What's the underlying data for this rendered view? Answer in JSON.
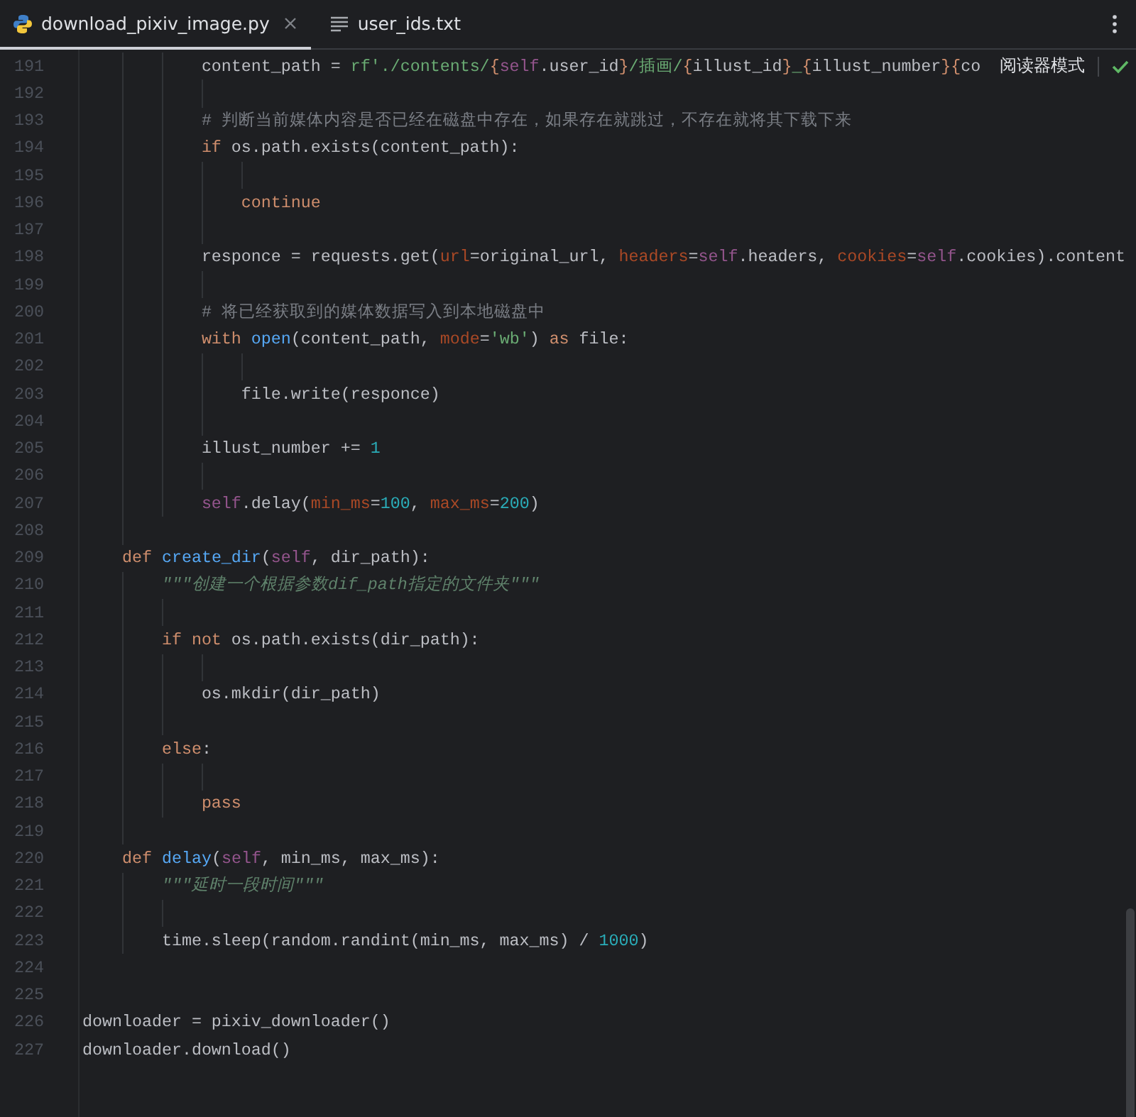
{
  "tabs": [
    {
      "label": "download_pixiv_image.py",
      "kind": "python",
      "selected": true,
      "closable": true
    },
    {
      "label": "user_ids.txt",
      "kind": "text",
      "selected": false,
      "closable": false
    }
  ],
  "reader_mode": {
    "label": "阅读器模式"
  },
  "code_lines": [
    {
      "number": "191",
      "tokens": [
        {
          "t": "            content_path = ",
          "kind": "plain"
        },
        {
          "t": "rf'./contents/",
          "kind": "str"
        },
        {
          "t": "{",
          "kind": "brace"
        },
        {
          "t": "self",
          "kind": "self"
        },
        {
          "t": ".user_id",
          "kind": "plain"
        },
        {
          "t": "}",
          "kind": "brace"
        },
        {
          "t": "/插画/",
          "kind": "str"
        },
        {
          "t": "{",
          "kind": "brace"
        },
        {
          "t": "illust_id",
          "kind": "plain"
        },
        {
          "t": "}",
          "kind": "brace"
        },
        {
          "t": "_",
          "kind": "str"
        },
        {
          "t": "{",
          "kind": "brace"
        },
        {
          "t": "illust_number",
          "kind": "plain"
        },
        {
          "t": "}{",
          "kind": "brace"
        },
        {
          "t": "co",
          "kind": "plain"
        }
      ]
    },
    {
      "number": "192"
    },
    {
      "number": "193",
      "tokens": [
        {
          "t": "            # 判断当前媒体内容是否已经在磁盘中存在，如果存在就跳过，不存在就将其下载下来",
          "kind": "comment"
        }
      ]
    },
    {
      "number": "194",
      "tokens": [
        {
          "t": "            if",
          "kind": "kw"
        },
        {
          "t": " os.path.exists(content_path):",
          "kind": "plain"
        }
      ]
    },
    {
      "number": "195"
    },
    {
      "number": "196",
      "tokens": [
        {
          "t": "                continue",
          "kind": "kw"
        }
      ]
    },
    {
      "number": "197"
    },
    {
      "number": "198",
      "tokens": [
        {
          "t": "            responce = requests.get(",
          "kind": "plain"
        },
        {
          "t": "url",
          "kind": "arg"
        },
        {
          "t": "=original_url, ",
          "kind": "plain"
        },
        {
          "t": "headers",
          "kind": "arg"
        },
        {
          "t": "=",
          "kind": "plain"
        },
        {
          "t": "self",
          "kind": "self"
        },
        {
          "t": ".headers, ",
          "kind": "plain"
        },
        {
          "t": "cookies",
          "kind": "arg"
        },
        {
          "t": "=",
          "kind": "plain"
        },
        {
          "t": "self",
          "kind": "self"
        },
        {
          "t": ".cookies).content",
          "kind": "plain"
        }
      ]
    },
    {
      "number": "199"
    },
    {
      "number": "200",
      "tokens": [
        {
          "t": "            # 将已经获取到的媒体数据写入到本地磁盘中",
          "kind": "comment"
        }
      ]
    },
    {
      "number": "201",
      "tokens": [
        {
          "t": "            with",
          "kind": "kw"
        },
        {
          "t": " open",
          "kind": "fn"
        },
        {
          "t": "(content_path, ",
          "kind": "plain"
        },
        {
          "t": "mode",
          "kind": "arg"
        },
        {
          "t": "=",
          "kind": "plain"
        },
        {
          "t": "'wb'",
          "kind": "str"
        },
        {
          "t": ") ",
          "kind": "plain"
        },
        {
          "t": "as",
          "kind": "kw"
        },
        {
          "t": " file:",
          "kind": "plain"
        }
      ]
    },
    {
      "number": "202"
    },
    {
      "number": "203",
      "tokens": [
        {
          "t": "                file.write(responce)",
          "kind": "plain"
        }
      ]
    },
    {
      "number": "204"
    },
    {
      "number": "205",
      "tokens": [
        {
          "t": "            illust_number += ",
          "kind": "plain"
        },
        {
          "t": "1",
          "kind": "num"
        }
      ]
    },
    {
      "number": "206"
    },
    {
      "number": "207",
      "tokens": [
        {
          "t": "            self",
          "kind": "self"
        },
        {
          "t": ".delay(",
          "kind": "plain"
        },
        {
          "t": "min_ms",
          "kind": "arg"
        },
        {
          "t": "=",
          "kind": "plain"
        },
        {
          "t": "100",
          "kind": "num"
        },
        {
          "t": ", ",
          "kind": "plain"
        },
        {
          "t": "max_ms",
          "kind": "arg"
        },
        {
          "t": "=",
          "kind": "plain"
        },
        {
          "t": "200",
          "kind": "num"
        },
        {
          "t": ")",
          "kind": "plain"
        }
      ]
    },
    {
      "number": "208"
    },
    {
      "number": "209",
      "tokens": [
        {
          "t": "    def",
          "kind": "kw"
        },
        {
          "t": " create_dir",
          "kind": "fn"
        },
        {
          "t": "(",
          "kind": "plain"
        },
        {
          "t": "self",
          "kind": "self"
        },
        {
          "t": ", dir_path):",
          "kind": "plain"
        }
      ]
    },
    {
      "number": "210",
      "tokens": [
        {
          "t": "        \"\"\"创建一个根据参数dif_path指定的文件夹\"\"\"",
          "kind": "doc"
        }
      ]
    },
    {
      "number": "211"
    },
    {
      "number": "212",
      "tokens": [
        {
          "t": "        if not",
          "kind": "kw"
        },
        {
          "t": " os.path.exists(dir_path):",
          "kind": "plain"
        }
      ]
    },
    {
      "number": "213"
    },
    {
      "number": "214",
      "tokens": [
        {
          "t": "            os.mkdir(dir_path)",
          "kind": "plain"
        }
      ]
    },
    {
      "number": "215"
    },
    {
      "number": "216",
      "tokens": [
        {
          "t": "        else",
          "kind": "kw"
        },
        {
          "t": ":",
          "kind": "plain"
        }
      ]
    },
    {
      "number": "217"
    },
    {
      "number": "218",
      "tokens": [
        {
          "t": "            pass",
          "kind": "kw"
        }
      ]
    },
    {
      "number": "219"
    },
    {
      "number": "220",
      "tokens": [
        {
          "t": "    def",
          "kind": "kw"
        },
        {
          "t": " delay",
          "kind": "fn"
        },
        {
          "t": "(",
          "kind": "plain"
        },
        {
          "t": "self",
          "kind": "self"
        },
        {
          "t": ", min_ms, max_ms):",
          "kind": "plain"
        }
      ]
    },
    {
      "number": "221",
      "tokens": [
        {
          "t": "        \"\"\"延时一段时间\"\"\"",
          "kind": "doc"
        }
      ]
    },
    {
      "number": "222"
    },
    {
      "number": "223",
      "tokens": [
        {
          "t": "        time.sleep(random.randint(min_ms, max_ms) / ",
          "kind": "plain"
        },
        {
          "t": "1000",
          "kind": "num"
        },
        {
          "t": ")",
          "kind": "plain"
        }
      ]
    },
    {
      "number": "224"
    },
    {
      "number": "225"
    },
    {
      "number": "226",
      "tokens": [
        {
          "t": "downloader = pixiv_downloader()",
          "kind": "plain"
        }
      ]
    },
    {
      "number": "227",
      "tokens": [
        {
          "t": "downloader.download()",
          "kind": "plain"
        }
      ]
    }
  ]
}
